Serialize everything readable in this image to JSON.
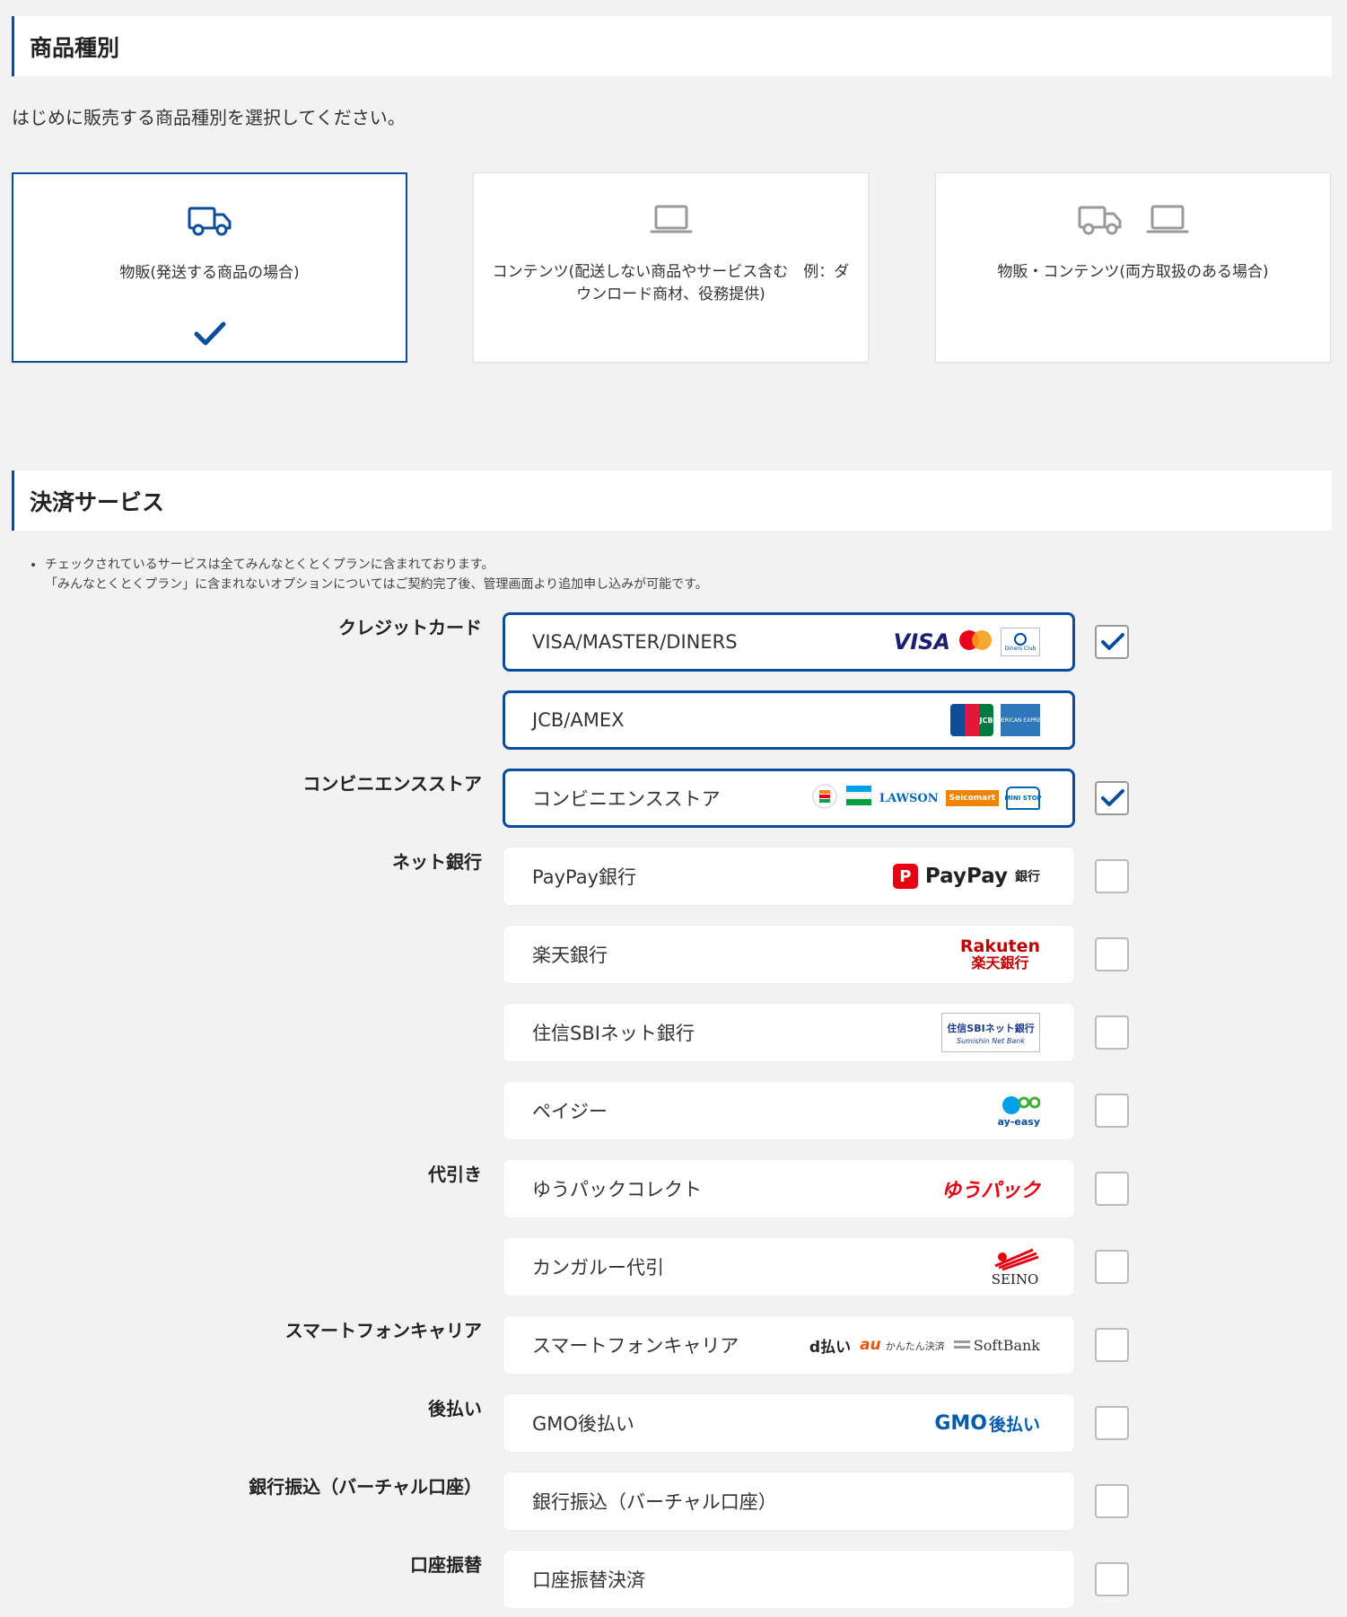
{
  "product_section": {
    "title": "商品種別",
    "intro": "はじめに販売する商品種別を選択してください。",
    "types": [
      {
        "label": "物販(発送する商品の場合)",
        "selected": true
      },
      {
        "label": "コンテンツ(配送しない商品やサービス含む　例：ダウンロード商材、役務提供)",
        "selected": false
      },
      {
        "label": "物販・コンテンツ(両方取扱のある場合)",
        "selected": false
      }
    ]
  },
  "payment_section": {
    "title": "決済サービス",
    "notes": [
      "チェックされているサービスは全てみんなとくとくプランに含まれております。",
      "「みんなとくとくプラン」に含まれないオプションについてはご契約完了後、管理画面より追加申し込みが可能です。"
    ],
    "categories": {
      "credit": "クレジットカード",
      "cvs": "コンビニエンスストア",
      "netbank": "ネット銀行",
      "cod": "代引き",
      "carrier": "スマートフォンキャリア",
      "postpay": "後払い",
      "transfer": "銀行振込（バーチャル口座）",
      "debit": "口座振替"
    },
    "rows": [
      {
        "name": "VISA/MASTER/DINERS",
        "checked": true
      },
      {
        "name": "JCB/AMEX",
        "checked": true
      },
      {
        "name": "コンビニエンスストア",
        "checked": true
      },
      {
        "name": "PayPay銀行",
        "checked": false
      },
      {
        "name": "楽天銀行",
        "checked": false
      },
      {
        "name": "住信SBIネット銀行",
        "checked": false
      },
      {
        "name": "ペイジー",
        "checked": false
      },
      {
        "name": "ゆうパックコレクト",
        "checked": false
      },
      {
        "name": "カンガルー代引",
        "checked": false
      },
      {
        "name": "スマートフォンキャリア",
        "checked": false
      },
      {
        "name": "GMO後払い",
        "checked": false
      },
      {
        "name": "銀行振込（バーチャル口座）",
        "checked": false
      },
      {
        "name": "口座振替決済",
        "checked": false
      }
    ],
    "logos": {
      "visa": "VISA",
      "diners": "Diners Club",
      "jcb": "JCB",
      "amex": "AMERICAN EXPRESS",
      "lawson": "LAWSON",
      "seicomart": "Seicomart",
      "ministop": "MINI STOP",
      "paypay": "PayPay",
      "paypay_bank": "銀行",
      "rakuten_en": "Rakuten",
      "rakuten_jp": "楽天銀行",
      "sbi_jp": "住信SBIネット銀行",
      "sbi_en": "Sumishin Net Bank",
      "payeasy": "ay-easy",
      "yupack": "ゆうパック",
      "seino": "SEINO",
      "dbarai": "d払い",
      "au": "au",
      "au_sub": "かんたん決済",
      "softbank": "SoftBank",
      "gmo": "GMO",
      "gmo_jp": "後払い"
    },
    "colors": {
      "accent": "#0b4d9c",
      "paypay_red": "#e60012",
      "rakuten_red": "#bf0000",
      "gmo_blue": "#005bac"
    }
  }
}
